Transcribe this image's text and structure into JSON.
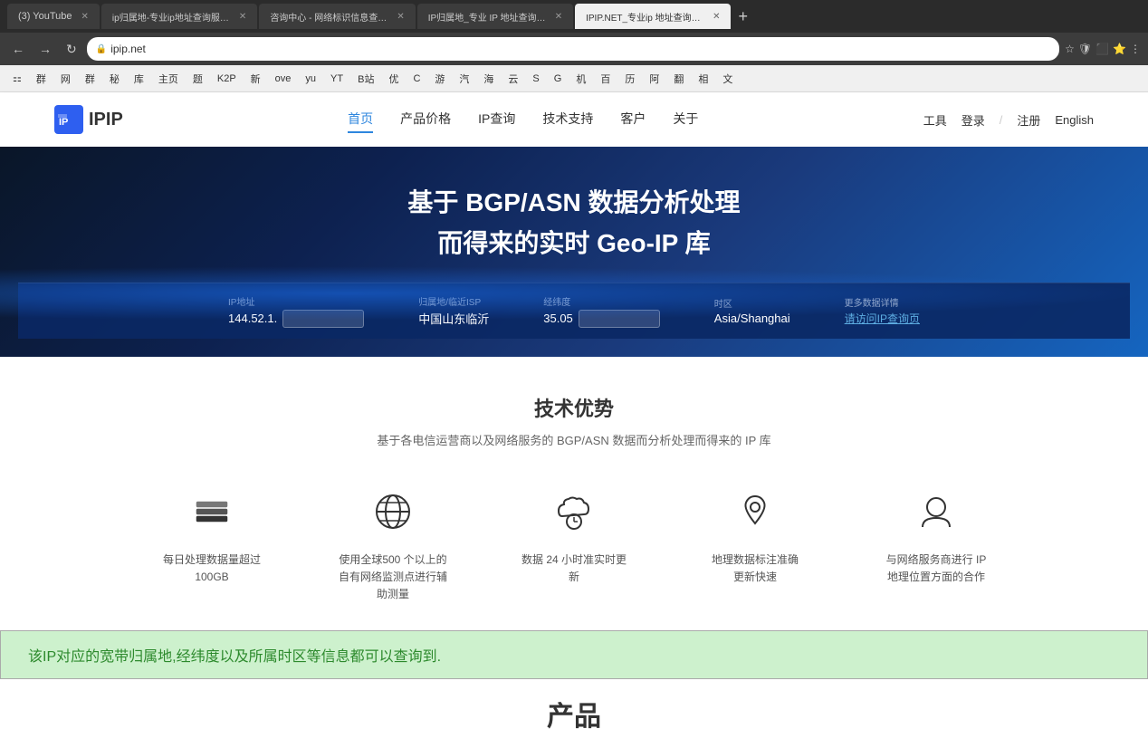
{
  "browser": {
    "tabs": [
      {
        "id": 1,
        "label": "(3) YouTube",
        "active": false
      },
      {
        "id": 2,
        "label": "ip归属地-专业ip地址查询服务_IP...",
        "active": false
      },
      {
        "id": 3,
        "label": "咨询中心 - 网络标识信息查询平台...",
        "active": false
      },
      {
        "id": 4,
        "label": "IP归属地_专业 IP 地址查询_IP...",
        "active": false
      },
      {
        "id": 5,
        "label": "IPIP.NET_专业ip 地址查询_IP...",
        "active": true
      }
    ],
    "address": "ipip.net",
    "bookmarks": [
      "群",
      "网",
      "群",
      "秘",
      "库",
      "主页",
      "题",
      "K2P",
      "新",
      "ove",
      "yu",
      "YT",
      "B站",
      "优",
      "C",
      "游",
      "汽",
      "海",
      "云",
      "S",
      "G",
      "机",
      "百",
      "历",
      "阿",
      "翻",
      "相",
      "文"
    ]
  },
  "header": {
    "logo_text": "IPIP",
    "nav_items": [
      {
        "label": "首页",
        "active": true
      },
      {
        "label": "产品价格",
        "active": false
      },
      {
        "label": "IP查询",
        "active": false
      },
      {
        "label": "技术支持",
        "active": false
      },
      {
        "label": "客户",
        "active": false
      },
      {
        "label": "关于",
        "active": false
      }
    ],
    "tools_label": "工具",
    "login_label": "登录",
    "register_label": "注册",
    "language_label": "English"
  },
  "hero": {
    "title_line1": "基于 BGP/ASN 数据分析处理",
    "title_line2": "而得来的实时 Geo-IP 库"
  },
  "ip_bar": {
    "items": [
      {
        "label": "IP地址",
        "value": "144.52.1."
      },
      {
        "label": "归属地/临近ISP",
        "value": "中国山东临沂"
      },
      {
        "label": "经纬度",
        "value": "35.05"
      },
      {
        "label": "时区",
        "value": "Asia/Shanghai"
      },
      {
        "label": "更多数据详情",
        "value": "请访问IP查询页"
      }
    ]
  },
  "tech_section": {
    "title": "技术优势",
    "subtitle": "基于各电信运营商以及网络服务的 BGP/ASN 数据而分析处理而得来的 IP 库",
    "features": [
      {
        "id": "data-volume",
        "icon_name": "layers-icon",
        "text": "每日处理数据量超过\n100GB"
      },
      {
        "id": "global-monitoring",
        "icon_name": "globe-icon",
        "text": "使用全球500 个以上的\n自有网络监测点进行辅\n助测量"
      },
      {
        "id": "realtime-update",
        "icon_name": "cloud-clock-icon",
        "text": "数据 24 小时准实时更\n新"
      },
      {
        "id": "geo-accuracy",
        "icon_name": "location-icon",
        "text": "地理数据标注准确\n更新快速"
      },
      {
        "id": "isp-cooperation",
        "icon_name": "person-icon",
        "text": "与网络服务商进行 IP\n地理位置方面的合作"
      }
    ]
  },
  "announcement": {
    "text": "该IP对应的宽带归属地,经纬度以及所属时区等信息都可以查询到."
  },
  "products_section": {
    "title": "产品"
  }
}
